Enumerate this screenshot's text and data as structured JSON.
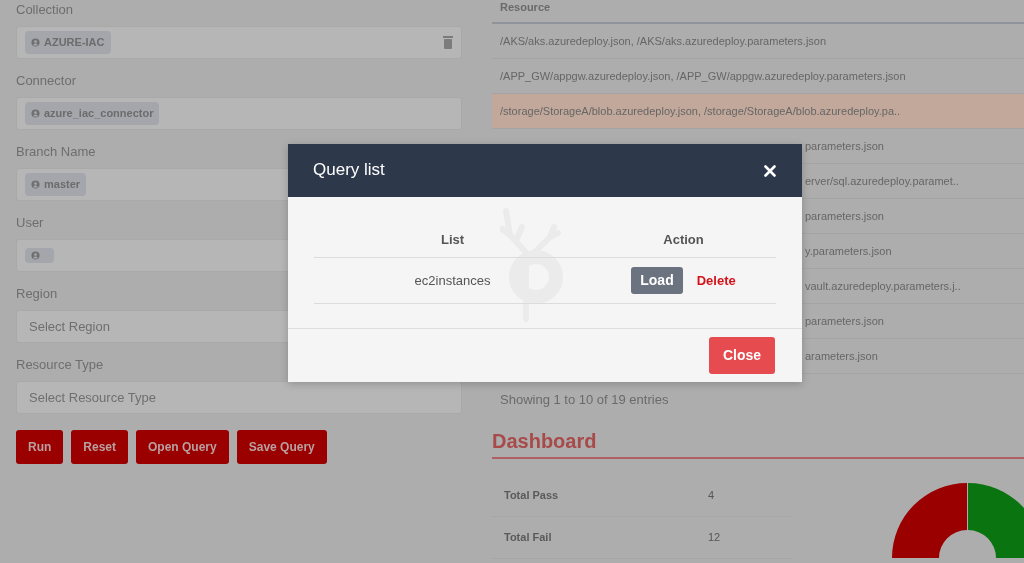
{
  "filters": [
    {
      "label": "Collection",
      "kind": "chip",
      "chip": "AZURE-IAC",
      "clearable": true
    },
    {
      "label": "Connector",
      "kind": "chip",
      "chip": "azure_iac_connector",
      "clearable": false
    },
    {
      "label": "Branch Name",
      "kind": "chip",
      "chip": "master"
    },
    {
      "label": "User",
      "kind": "blank-chip"
    },
    {
      "label": "Region",
      "kind": "select",
      "placeholder": "Select Region"
    },
    {
      "label": "Resource Type",
      "kind": "select",
      "placeholder": "Select Resource Type"
    }
  ],
  "buttons": [
    "Run",
    "Reset",
    "Open Query",
    "Save Query"
  ],
  "resource_table": {
    "column": "Resource",
    "rows": [
      {
        "kind": "full",
        "text": "/AKS/aks.azuredeploy.json, /AKS/aks.azuredeploy.parameters.json",
        "highlighted": false
      },
      {
        "kind": "full",
        "text": "/APP_GW/appgw.azuredeploy.json, /APP_GW/appgw.azuredeploy.parameters.json",
        "highlighted": false
      },
      {
        "kind": "full",
        "text": "/storage/StorageA/blob.azuredeploy.json, /storage/StorageA/blob.azuredeploy.pa..",
        "highlighted": true
      },
      {
        "kind": "partial",
        "text": "parameters.json",
        "highlighted": false
      },
      {
        "kind": "partial",
        "text": "erver/sql.azuredeploy.paramet..",
        "highlighted": false
      },
      {
        "kind": "partial",
        "text": "parameters.json",
        "highlighted": false
      },
      {
        "kind": "partial",
        "text": "y.parameters.json",
        "highlighted": false
      },
      {
        "kind": "partial",
        "text": "vault.azuredeploy.parameters.j..",
        "highlighted": false
      },
      {
        "kind": "partial",
        "text": "parameters.json",
        "highlighted": false
      },
      {
        "kind": "partial",
        "text": "arameters.json",
        "highlighted": false
      }
    ]
  },
  "table_info": "Showing 1 to 10 of 19 entries",
  "dashboard": {
    "title": "Dashboard",
    "stats": [
      {
        "label": "Total Pass",
        "value": "4"
      },
      {
        "label": "Total Fail",
        "value": "12"
      }
    ]
  },
  "dialog": {
    "title": "Query list",
    "columns": [
      "List",
      "Action"
    ],
    "rows": [
      {
        "name": "ec2instances",
        "actions": [
          {
            "kind": "button",
            "label": "Load"
          },
          {
            "kind": "link",
            "label": "Delete"
          }
        ]
      }
    ],
    "footer_button": "Close"
  }
}
